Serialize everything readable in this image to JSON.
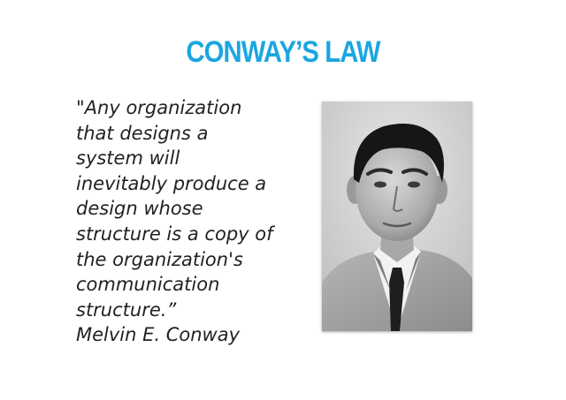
{
  "slide": {
    "title": "CONWAY’S LAW",
    "quote_lines": [
      "\"Any organization",
      "that designs a",
      "system will",
      "inevitably produce a",
      "design whose",
      "structure is a copy of",
      "the organization's",
      "communication",
      "structure.”",
      "Melvin E. Conway"
    ]
  },
  "colors": {
    "title": "#1aa6e0",
    "text": "#222222"
  }
}
